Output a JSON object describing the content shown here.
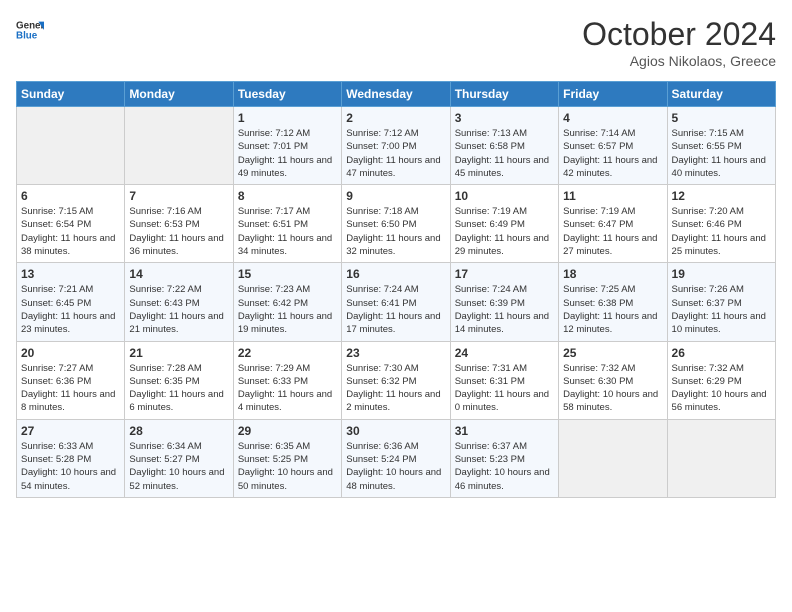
{
  "header": {
    "logo_line1": "General",
    "logo_line2": "Blue",
    "month": "October 2024",
    "location": "Agios Nikolaos, Greece"
  },
  "weekdays": [
    "Sunday",
    "Monday",
    "Tuesday",
    "Wednesday",
    "Thursday",
    "Friday",
    "Saturday"
  ],
  "weeks": [
    [
      {
        "day": "",
        "sunrise": "",
        "sunset": "",
        "daylight": ""
      },
      {
        "day": "",
        "sunrise": "",
        "sunset": "",
        "daylight": ""
      },
      {
        "day": "1",
        "sunrise": "Sunrise: 7:12 AM",
        "sunset": "Sunset: 7:01 PM",
        "daylight": "Daylight: 11 hours and 49 minutes."
      },
      {
        "day": "2",
        "sunrise": "Sunrise: 7:12 AM",
        "sunset": "Sunset: 7:00 PM",
        "daylight": "Daylight: 11 hours and 47 minutes."
      },
      {
        "day": "3",
        "sunrise": "Sunrise: 7:13 AM",
        "sunset": "Sunset: 6:58 PM",
        "daylight": "Daylight: 11 hours and 45 minutes."
      },
      {
        "day": "4",
        "sunrise": "Sunrise: 7:14 AM",
        "sunset": "Sunset: 6:57 PM",
        "daylight": "Daylight: 11 hours and 42 minutes."
      },
      {
        "day": "5",
        "sunrise": "Sunrise: 7:15 AM",
        "sunset": "Sunset: 6:55 PM",
        "daylight": "Daylight: 11 hours and 40 minutes."
      }
    ],
    [
      {
        "day": "6",
        "sunrise": "Sunrise: 7:15 AM",
        "sunset": "Sunset: 6:54 PM",
        "daylight": "Daylight: 11 hours and 38 minutes."
      },
      {
        "day": "7",
        "sunrise": "Sunrise: 7:16 AM",
        "sunset": "Sunset: 6:53 PM",
        "daylight": "Daylight: 11 hours and 36 minutes."
      },
      {
        "day": "8",
        "sunrise": "Sunrise: 7:17 AM",
        "sunset": "Sunset: 6:51 PM",
        "daylight": "Daylight: 11 hours and 34 minutes."
      },
      {
        "day": "9",
        "sunrise": "Sunrise: 7:18 AM",
        "sunset": "Sunset: 6:50 PM",
        "daylight": "Daylight: 11 hours and 32 minutes."
      },
      {
        "day": "10",
        "sunrise": "Sunrise: 7:19 AM",
        "sunset": "Sunset: 6:49 PM",
        "daylight": "Daylight: 11 hours and 29 minutes."
      },
      {
        "day": "11",
        "sunrise": "Sunrise: 7:19 AM",
        "sunset": "Sunset: 6:47 PM",
        "daylight": "Daylight: 11 hours and 27 minutes."
      },
      {
        "day": "12",
        "sunrise": "Sunrise: 7:20 AM",
        "sunset": "Sunset: 6:46 PM",
        "daylight": "Daylight: 11 hours and 25 minutes."
      }
    ],
    [
      {
        "day": "13",
        "sunrise": "Sunrise: 7:21 AM",
        "sunset": "Sunset: 6:45 PM",
        "daylight": "Daylight: 11 hours and 23 minutes."
      },
      {
        "day": "14",
        "sunrise": "Sunrise: 7:22 AM",
        "sunset": "Sunset: 6:43 PM",
        "daylight": "Daylight: 11 hours and 21 minutes."
      },
      {
        "day": "15",
        "sunrise": "Sunrise: 7:23 AM",
        "sunset": "Sunset: 6:42 PM",
        "daylight": "Daylight: 11 hours and 19 minutes."
      },
      {
        "day": "16",
        "sunrise": "Sunrise: 7:24 AM",
        "sunset": "Sunset: 6:41 PM",
        "daylight": "Daylight: 11 hours and 17 minutes."
      },
      {
        "day": "17",
        "sunrise": "Sunrise: 7:24 AM",
        "sunset": "Sunset: 6:39 PM",
        "daylight": "Daylight: 11 hours and 14 minutes."
      },
      {
        "day": "18",
        "sunrise": "Sunrise: 7:25 AM",
        "sunset": "Sunset: 6:38 PM",
        "daylight": "Daylight: 11 hours and 12 minutes."
      },
      {
        "day": "19",
        "sunrise": "Sunrise: 7:26 AM",
        "sunset": "Sunset: 6:37 PM",
        "daylight": "Daylight: 11 hours and 10 minutes."
      }
    ],
    [
      {
        "day": "20",
        "sunrise": "Sunrise: 7:27 AM",
        "sunset": "Sunset: 6:36 PM",
        "daylight": "Daylight: 11 hours and 8 minutes."
      },
      {
        "day": "21",
        "sunrise": "Sunrise: 7:28 AM",
        "sunset": "Sunset: 6:35 PM",
        "daylight": "Daylight: 11 hours and 6 minutes."
      },
      {
        "day": "22",
        "sunrise": "Sunrise: 7:29 AM",
        "sunset": "Sunset: 6:33 PM",
        "daylight": "Daylight: 11 hours and 4 minutes."
      },
      {
        "day": "23",
        "sunrise": "Sunrise: 7:30 AM",
        "sunset": "Sunset: 6:32 PM",
        "daylight": "Daylight: 11 hours and 2 minutes."
      },
      {
        "day": "24",
        "sunrise": "Sunrise: 7:31 AM",
        "sunset": "Sunset: 6:31 PM",
        "daylight": "Daylight: 11 hours and 0 minutes."
      },
      {
        "day": "25",
        "sunrise": "Sunrise: 7:32 AM",
        "sunset": "Sunset: 6:30 PM",
        "daylight": "Daylight: 10 hours and 58 minutes."
      },
      {
        "day": "26",
        "sunrise": "Sunrise: 7:32 AM",
        "sunset": "Sunset: 6:29 PM",
        "daylight": "Daylight: 10 hours and 56 minutes."
      }
    ],
    [
      {
        "day": "27",
        "sunrise": "Sunrise: 6:33 AM",
        "sunset": "Sunset: 5:28 PM",
        "daylight": "Daylight: 10 hours and 54 minutes."
      },
      {
        "day": "28",
        "sunrise": "Sunrise: 6:34 AM",
        "sunset": "Sunset: 5:27 PM",
        "daylight": "Daylight: 10 hours and 52 minutes."
      },
      {
        "day": "29",
        "sunrise": "Sunrise: 6:35 AM",
        "sunset": "Sunset: 5:25 PM",
        "daylight": "Daylight: 10 hours and 50 minutes."
      },
      {
        "day": "30",
        "sunrise": "Sunrise: 6:36 AM",
        "sunset": "Sunset: 5:24 PM",
        "daylight": "Daylight: 10 hours and 48 minutes."
      },
      {
        "day": "31",
        "sunrise": "Sunrise: 6:37 AM",
        "sunset": "Sunset: 5:23 PM",
        "daylight": "Daylight: 10 hours and 46 minutes."
      },
      {
        "day": "",
        "sunrise": "",
        "sunset": "",
        "daylight": ""
      },
      {
        "day": "",
        "sunrise": "",
        "sunset": "",
        "daylight": ""
      }
    ]
  ]
}
